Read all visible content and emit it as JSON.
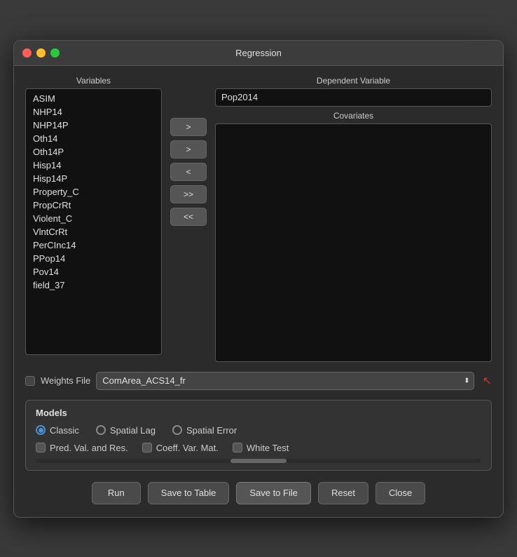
{
  "window": {
    "title": "Regression"
  },
  "variables": {
    "label": "Variables",
    "items": [
      "ASIM",
      "NHP14",
      "NHP14P",
      "Oth14",
      "Oth14P",
      "Hisp14",
      "Hisp14P",
      "Property_C",
      "PropCrRt",
      "Violent_C",
      "VlntCrRt",
      "PerCInc14",
      "PPop14",
      "Pov14",
      "field_37"
    ]
  },
  "dependent_variable": {
    "label": "Dependent Variable",
    "value": "Pop2014"
  },
  "covariates": {
    "label": "Covariates"
  },
  "arrow_buttons": {
    "add_dep": ">",
    "add_cov": ">",
    "remove_cov": "<",
    "add_all": ">>",
    "remove_all": "<<"
  },
  "weights": {
    "label": "Weights File",
    "value": "ComArea_ACS14_fr",
    "options": [
      "ComArea_ACS14_fr"
    ]
  },
  "models": {
    "title": "Models",
    "radio_options": [
      {
        "label": "Classic",
        "selected": true
      },
      {
        "label": "Spatial Lag",
        "selected": false
      },
      {
        "label": "Spatial Error",
        "selected": false
      }
    ],
    "checkboxes": [
      {
        "label": "Pred. Val. and Res.",
        "checked": false
      },
      {
        "label": "Coeff. Var. Mat.",
        "checked": false
      },
      {
        "label": "White Test",
        "checked": false
      }
    ]
  },
  "buttons": {
    "run": "Run",
    "save_to_table": "Save to Table",
    "save_to_file": "Save to File",
    "reset": "Reset",
    "close": "Close"
  }
}
